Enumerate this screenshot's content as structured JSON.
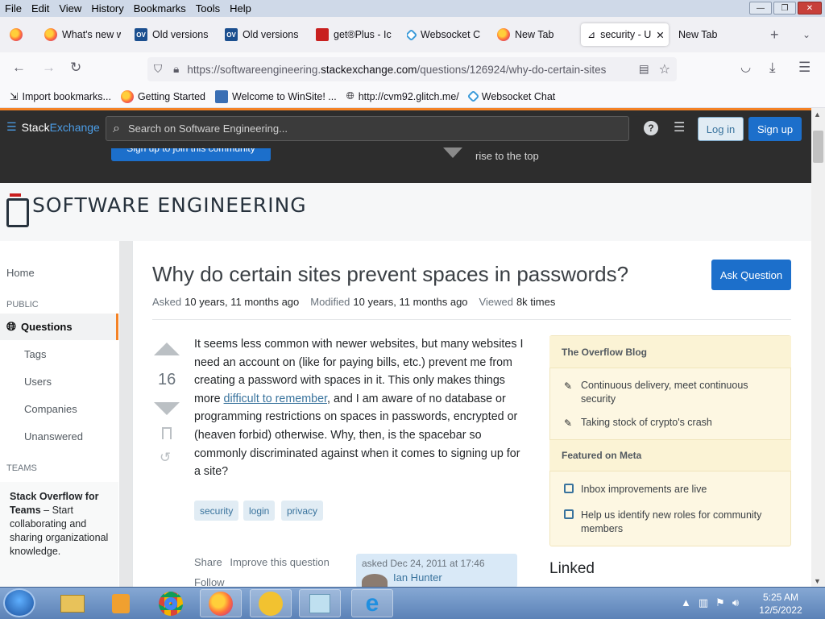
{
  "menu": [
    "File",
    "Edit",
    "View",
    "History",
    "Bookmarks",
    "Tools",
    "Help"
  ],
  "window_controls": {
    "minimize": "—",
    "maximize": "❐",
    "close": "✕"
  },
  "tabs": [
    {
      "label": "What's new w",
      "icon": "firefox-icon"
    },
    {
      "label": "Old versions",
      "icon": "oldversion-icon"
    },
    {
      "label": "Old versions",
      "icon": "oldversion-icon"
    },
    {
      "label": "get®Plus - Ic",
      "icon": "pdf-icon"
    },
    {
      "label": "Websocket C",
      "icon": "websocket-icon"
    },
    {
      "label": "New Tab",
      "icon": "firefox-icon"
    },
    {
      "label": "security - U",
      "icon": "stackexchange-icon",
      "active": true
    },
    {
      "label": "New Tab",
      "icon": ""
    }
  ],
  "nav": {
    "url_prefix": "https://softwareengineering.",
    "url_domain": "stackexchange.com",
    "url_suffix": "/questions/126924/why-do-certain-sites"
  },
  "bookmarks": [
    "Import bookmarks...",
    "Getting Started",
    "Welcome to WinSite! ...",
    "http://cvm92.glitch.me/",
    "Websocket Chat"
  ],
  "se_header": {
    "logo_a": "Stack",
    "logo_b": "Exchange",
    "search_placeholder": "Search on Software Engineering...",
    "login": "Log in",
    "signup": "Sign up",
    "banner_button": "Sign up to join this community",
    "banner_text": "rise to the top"
  },
  "site_title": "SOFTWARE ENGINEERING",
  "leftnav": {
    "home": "Home",
    "public_header": "PUBLIC",
    "questions": "Questions",
    "tags": "Tags",
    "users": "Users",
    "companies": "Companies",
    "unanswered": "Unanswered",
    "teams_header": "TEAMS",
    "teams_title": "Stack Overflow for Teams",
    "teams_text": " – Start collaborating and sharing organizational knowledge."
  },
  "question": {
    "title": "Why do certain sites prevent spaces in passwords?",
    "ask_button": "Ask Question",
    "asked_label": "Asked",
    "asked_value": "10 years, 11 months ago",
    "modified_label": "Modified",
    "modified_value": "10 years, 11 months ago",
    "viewed_label": "Viewed",
    "viewed_value": "8k times",
    "score": "16",
    "body_1": "It seems less common with newer websites, but many websites I need an account on (like for paying bills, etc.) prevent me from creating a password with spaces in it. This only makes things more ",
    "body_link": "difficult to remember",
    "body_2": ", and I am aware of no database or programming restrictions on spaces in passwords, encrypted or (heaven forbid) otherwise. Why, then, is the spacebar so commonly discriminated against when it comes to signing up for a site?",
    "tags": [
      "security",
      "login",
      "privacy"
    ],
    "share": "Share",
    "improve": "Improve this question",
    "follow": "Follow",
    "asked_card": "asked Dec 24, 2011 at 17:46",
    "author": "Ian Hunter"
  },
  "sidebar": {
    "blog_header": "The Overflow Blog",
    "blog_items": [
      "Continuous delivery, meet continuous security",
      "Taking stock of crypto's crash"
    ],
    "meta_header": "Featured on Meta",
    "meta_items": [
      "Inbox improvements are live",
      "Help us identify new roles for community members"
    ],
    "linked": "Linked"
  },
  "taskbar": {
    "time": "5:25 AM",
    "date": "12/5/2022"
  },
  "colors": {
    "accent": "#f48225",
    "link": "#39739d",
    "button": "#1c6fcb"
  }
}
